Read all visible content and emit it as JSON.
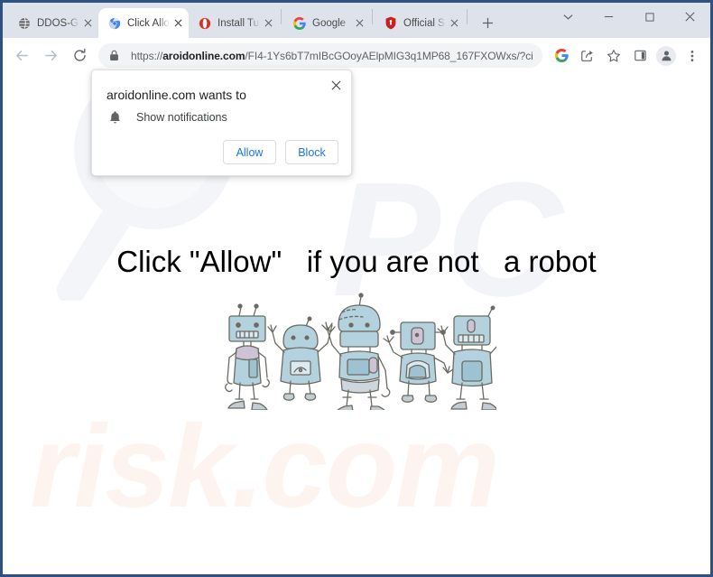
{
  "window": {
    "controls": [
      {
        "name": "tab-search",
        "glyph": "⌄"
      },
      {
        "name": "minimize",
        "glyph": "–"
      },
      {
        "name": "maximize",
        "glyph": "□"
      },
      {
        "name": "close",
        "glyph": "✕"
      }
    ]
  },
  "tabs": [
    {
      "title": "DDOS-GU",
      "favicon": "globe-icon",
      "active": false
    },
    {
      "title": "Click Allow",
      "favicon": "chrome-icon",
      "active": true
    },
    {
      "title": "Install Tur",
      "favicon": "opera-red-circle-icon",
      "active": false
    },
    {
      "title": "Google",
      "favicon": "google-g-icon",
      "active": false
    },
    {
      "title": "Official Sit",
      "favicon": "red-shield-icon",
      "active": false
    }
  ],
  "newtab_label": "+",
  "toolbar": {
    "back_label": "←",
    "forward_label": "→",
    "reload_label": "⟳",
    "url_prefix": "https://",
    "url_domain": "aroidonline.com",
    "url_path": "/FI4-1Ys6bT7mIBcGOoyAElpMIG3q1MP68_167FXOWxs/?ci...",
    "icons": [
      "google-lens-icon",
      "share-icon",
      "bookmark-star-icon",
      "side-panel-icon",
      "profile-avatar-icon",
      "three-dot-menu-icon"
    ]
  },
  "permission_dialog": {
    "title": "aroidonline.com wants to",
    "permission_label": "Show notifications",
    "permission_icon": "bell-icon",
    "allow_label": "Allow",
    "block_label": "Block",
    "close_label": "✕",
    "accent_color": "#1a73e8"
  },
  "page": {
    "headline": "Click \"Allow\"   if you are not   a robot",
    "robot_image_alt": "five-cartoon-robots",
    "watermark_pc": "PC",
    "watermark_risk": "risk.com",
    "watermark_magnifier": "magnifier-icon",
    "robot_body_color": "#a9cdd9",
    "robot_outline_color": "#6b6b63"
  }
}
